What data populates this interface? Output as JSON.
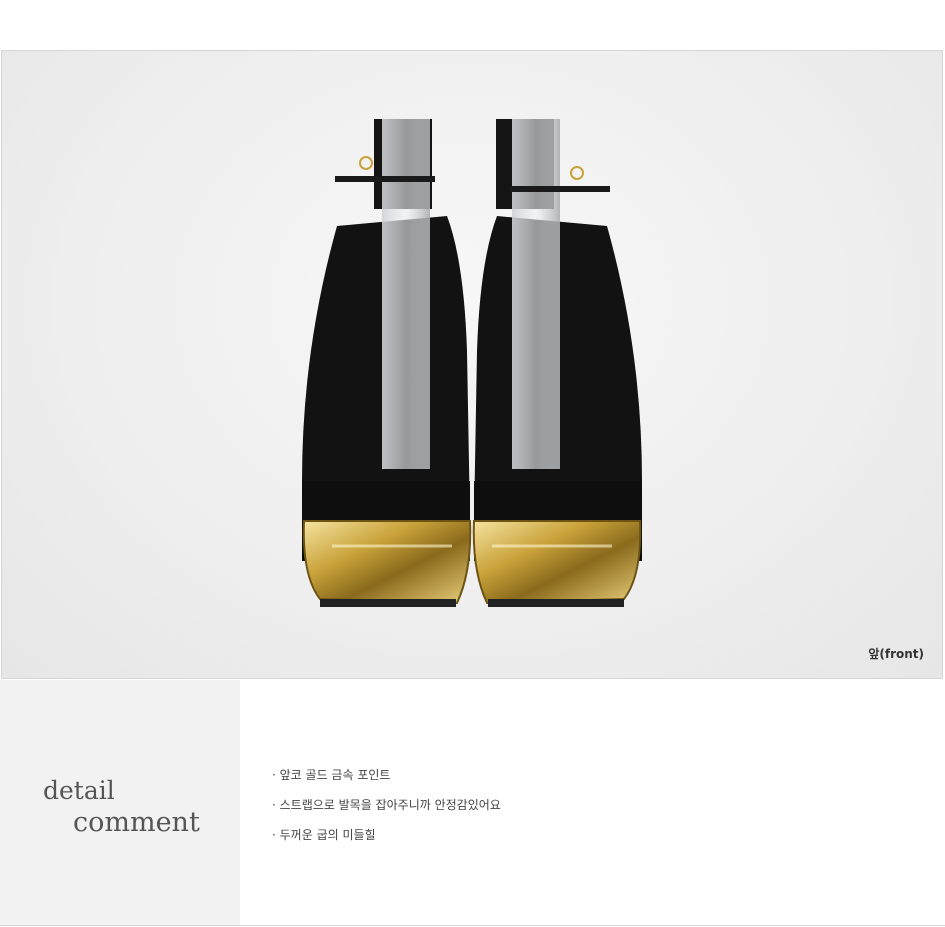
{
  "photo": {
    "caption": "앞(front)"
  },
  "detail": {
    "title_line1": "detail",
    "title_line2": "comment",
    "bullets": [
      "· 앞코 골드 금속 포인트",
      "· 스트랩으로 발목을 잡아주니까 안정감있어요",
      "· 두꺼운 굽의 미들힐"
    ]
  },
  "colors": {
    "panel": "#f2f2f2",
    "shoe": "#111111",
    "gold": "#c9a23a"
  }
}
